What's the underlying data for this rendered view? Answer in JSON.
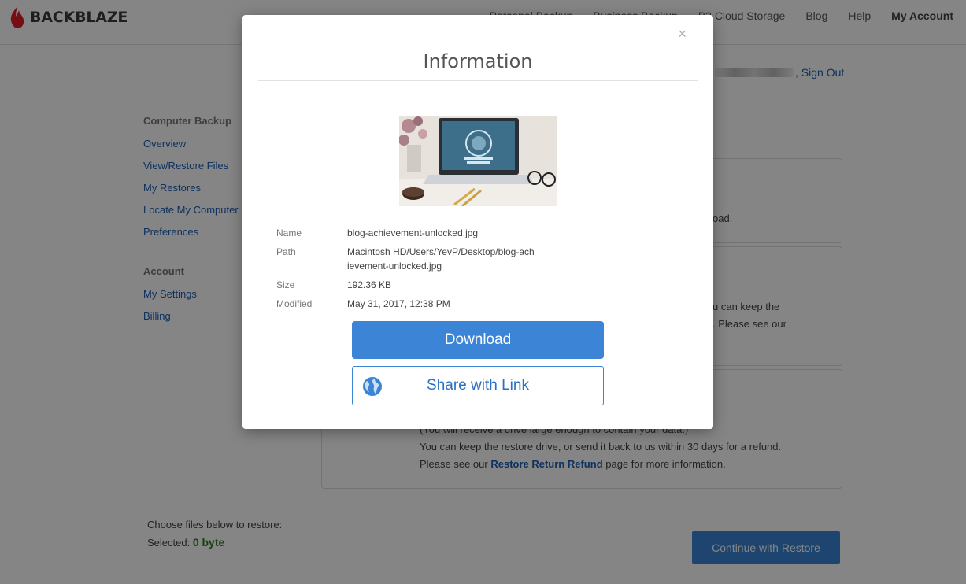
{
  "header": {
    "logo_text_1": "BACK",
    "logo_text_2": "BLAZE",
    "nav": [
      "Personal Backup",
      "Business Backup",
      "B2 Cloud Storage",
      "Blog",
      "Help",
      "My Account"
    ]
  },
  "account_bar": {
    "sign_out": ", Sign Out"
  },
  "sidebar": {
    "section1": "Computer Backup",
    "items1": [
      "Overview",
      "View/Restore Files",
      "My Restores",
      "Locate My Computer",
      "Preferences"
    ],
    "section2": "Account",
    "items2": [
      "My Settings",
      "Billing"
    ]
  },
  "cards": {
    "card1_partial": "oad.",
    "card2_partial_1": "u can keep the",
    "card2_partial_2": ". Please see our",
    "card3_line1": "(You will receive a drive large enough to contain your data.)",
    "card3_line2": "You can keep the restore drive, or send it back to us within 30 days for a refund.",
    "card3_line3_pre": "Please see our ",
    "card3_line3_link": "Restore Return Refund",
    "card3_line3_post": " page for more information."
  },
  "footer": {
    "choose_text": "Choose files below to restore:",
    "selected_label": "Selected: ",
    "selected_value": "0 byte",
    "continue_button": "Continue with Restore"
  },
  "modal": {
    "title": "Information",
    "close": "×",
    "fields": {
      "name_label": "Name",
      "name_value": "blog-achievement-unlocked.jpg",
      "path_label": "Path",
      "path_value": "Macintosh HD/Users/YevP/Desktop/blog-achievement-unlocked.jpg",
      "size_label": "Size",
      "size_value": "192.36 KB",
      "modified_label": "Modified",
      "modified_value": "May 31, 2017, 12:38 PM"
    },
    "download_button": "Download",
    "share_button": "Share with Link"
  },
  "colors": {
    "brand_red": "#e01e27",
    "accent_blue": "#3b84d6",
    "link_blue": "#1b5fb5",
    "selected_green": "#2e7d1e"
  }
}
